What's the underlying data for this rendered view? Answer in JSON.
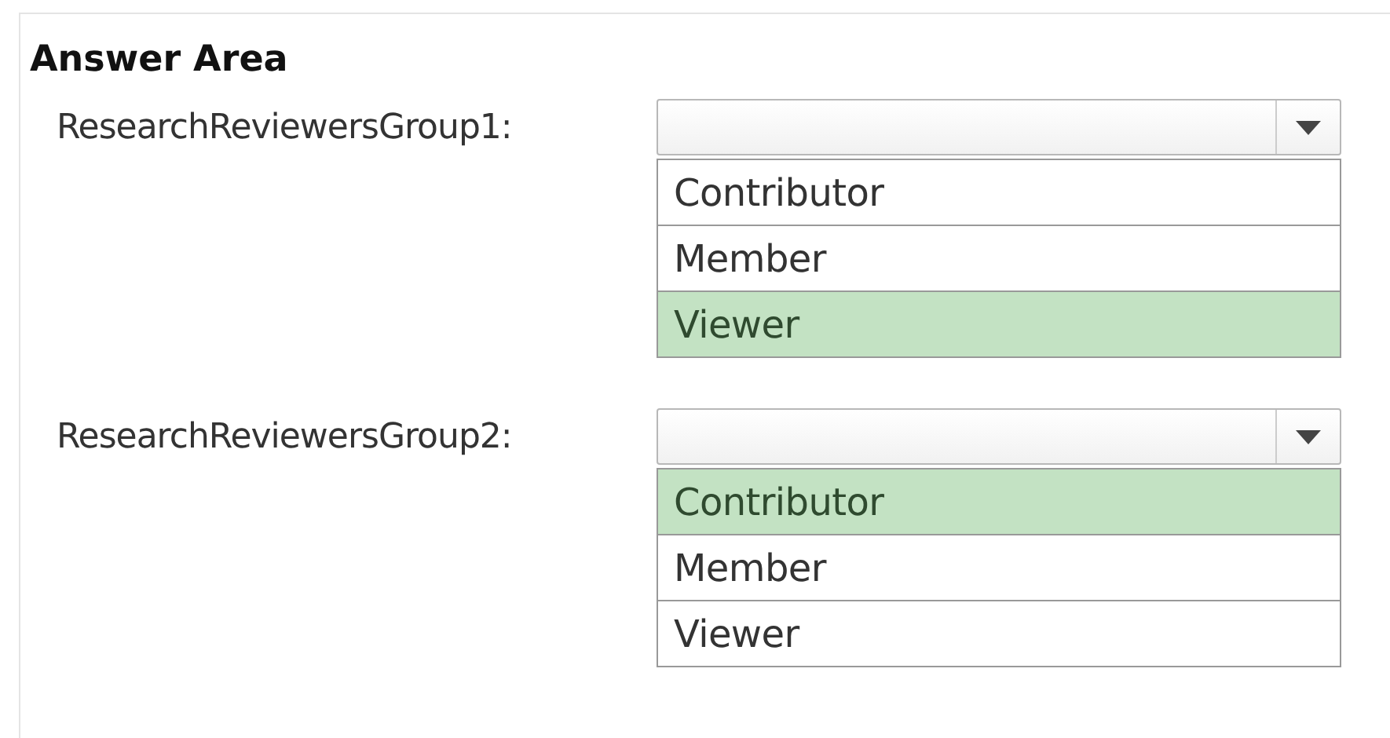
{
  "title": "Answer Area",
  "questions": [
    {
      "label": "ResearchReviewersGroup1:",
      "options": [
        {
          "label": "Contributor",
          "selected": false
        },
        {
          "label": "Member",
          "selected": false
        },
        {
          "label": "Viewer",
          "selected": true
        }
      ]
    },
    {
      "label": "ResearchReviewersGroup2:",
      "options": [
        {
          "label": "Contributor",
          "selected": true
        },
        {
          "label": "Member",
          "selected": false
        },
        {
          "label": "Viewer",
          "selected": false
        }
      ]
    }
  ]
}
